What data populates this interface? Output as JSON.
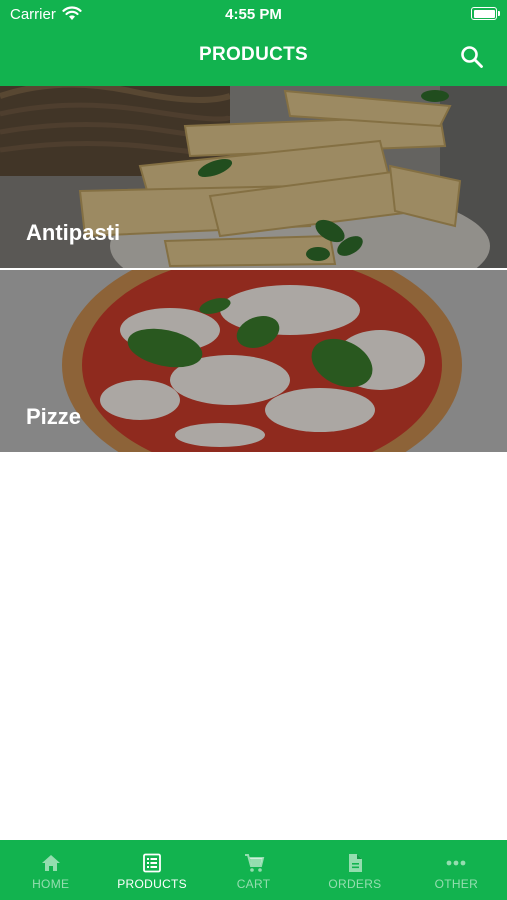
{
  "status_bar": {
    "carrier": "Carrier",
    "time": "4:55 PM"
  },
  "header": {
    "title": "PRODUCTS",
    "search_icon": "search-icon"
  },
  "categories": [
    {
      "label": "Antipasti",
      "image": "garlic-flatbread-image"
    },
    {
      "label": "Pizze",
      "image": "margherita-pizza-image"
    }
  ],
  "tabs": [
    {
      "label": "HOME",
      "icon": "home-icon",
      "active": false
    },
    {
      "label": "PRODUCTS",
      "icon": "list-icon",
      "active": true
    },
    {
      "label": "CART",
      "icon": "cart-icon",
      "active": false
    },
    {
      "label": "ORDERS",
      "icon": "document-icon",
      "active": false
    },
    {
      "label": "OTHER",
      "icon": "more-icon",
      "active": false
    }
  ],
  "colors": {
    "brand": "#12b34f",
    "inactive_tab": "rgba(255,255,255,0.55)"
  }
}
